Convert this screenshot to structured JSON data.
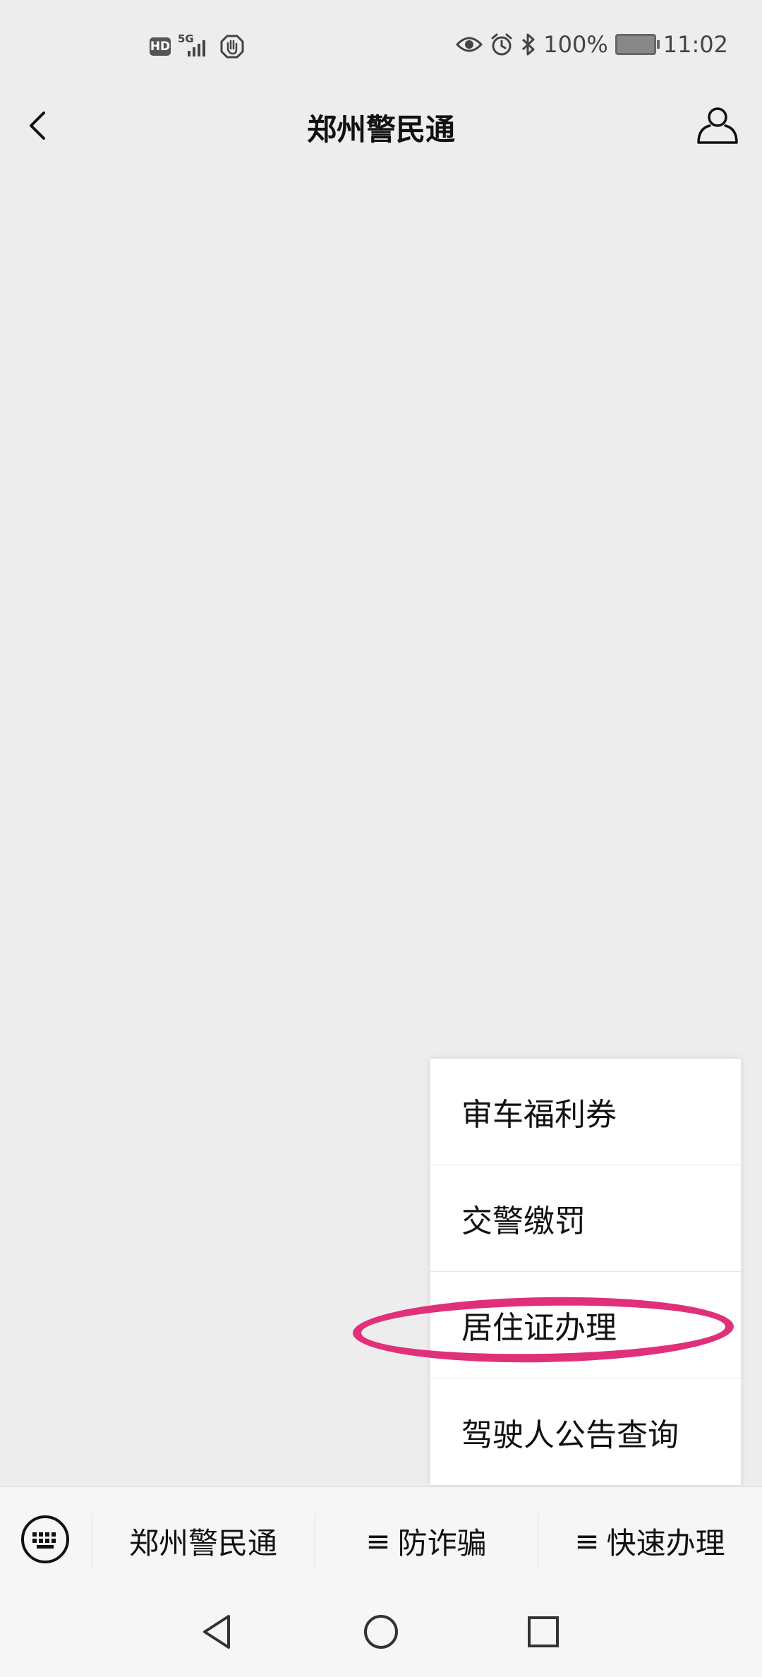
{
  "status_bar": {
    "hd_label": "HD",
    "network_label": "5G",
    "battery_percent": "100%",
    "time": "11:02",
    "icons": [
      "hd-icon",
      "signal-icon",
      "hand-icon",
      "eye-icon",
      "alarm-icon",
      "bluetooth-icon",
      "battery-icon"
    ]
  },
  "nav": {
    "title": "郑州警民通",
    "back_icon": "chevron-left-icon",
    "profile_icon": "user-icon"
  },
  "popup_menu": {
    "items": [
      {
        "label": "审车福利券"
      },
      {
        "label": "交警缴罚"
      },
      {
        "label": "居住证办理"
      },
      {
        "label": "驾驶人公告查询"
      }
    ],
    "highlight_color": "#e0307a"
  },
  "bottom_menu": {
    "keyboard_icon": "keyboard-icon",
    "tabs": [
      {
        "label": "郑州警民通"
      },
      {
        "label": "防诈骗",
        "icon": "menu-icon"
      },
      {
        "label": "快速办理",
        "icon": "menu-icon"
      }
    ]
  },
  "system_nav": {
    "icons": [
      "back-triangle-icon",
      "home-circle-icon",
      "recents-square-icon"
    ]
  }
}
